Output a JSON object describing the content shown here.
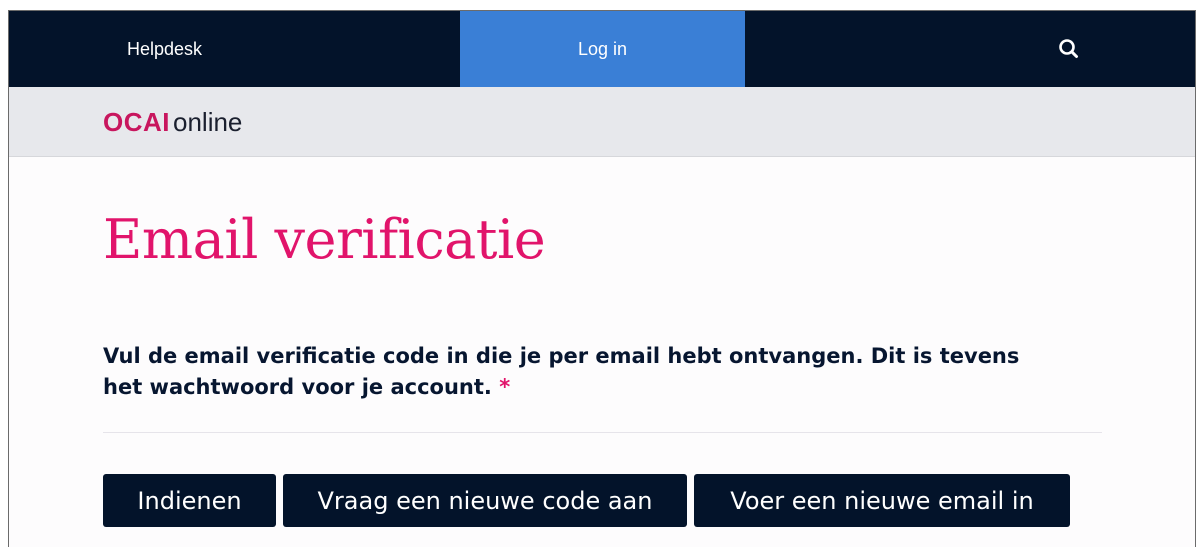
{
  "nav": {
    "helpdesk_label": "Helpdesk",
    "login_label": "Log in",
    "search_icon": "search-icon"
  },
  "brand": {
    "logo_strong": "OCAI",
    "logo_light": "online",
    "accent_color": "#e1146b",
    "nav_color": "#03132a",
    "active_tab_color": "#3a7fd6"
  },
  "main": {
    "title": "Email verificatie",
    "instruction": "Vul de email verificatie code in die je per email hebt ontvangen. Dit is tevens het wachtwoord voor je account.",
    "required_marker": "*"
  },
  "actions": {
    "submit_label": "Indienen",
    "new_code_label": "Vraag een nieuwe code aan",
    "new_email_label": "Voer een nieuwe email in"
  }
}
